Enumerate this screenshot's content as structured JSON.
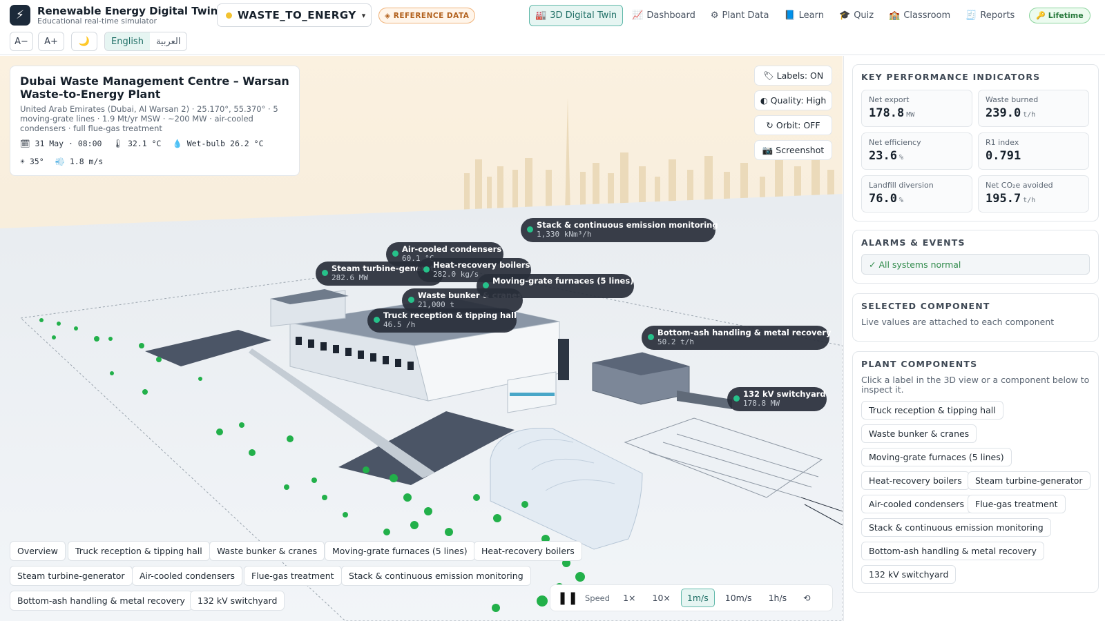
{
  "app": {
    "title": "Renewable Energy Digital Twin",
    "subtitle": "Educational real-time simulator",
    "logo": "⚡"
  },
  "plant_select": {
    "value": "WASTE_TO_ENERGY",
    "chevron": "▾"
  },
  "reference_badge": "◈ REFERENCE DATA",
  "nav": [
    {
      "icon": "🏭",
      "label": "3D Digital Twin",
      "active": true
    },
    {
      "icon": "📈",
      "label": "Dashboard"
    },
    {
      "icon": "⚙",
      "label": "Plant Data"
    },
    {
      "icon": "📘",
      "label": "Learn"
    },
    {
      "icon": "🎓",
      "label": "Quiz"
    },
    {
      "icon": "🏫",
      "label": "Classroom"
    },
    {
      "icon": "🧾",
      "label": "Reports"
    }
  ],
  "lifetime_badge": "🔑 Lifetime",
  "font_controls": {
    "decrease": "A−",
    "increase": "A+",
    "theme_icon": "🌙"
  },
  "language": {
    "english": "English",
    "arabic": "العربية"
  },
  "site": {
    "title": "Dubai Waste Management Centre – Warsan Waste-to-Energy Plant",
    "description": "United Arab Emirates (Dubai, Al Warsan 2) · 25.170°, 55.370° · 5 moving-grate lines · 1.9 Mt/yr MSW · ~200 MW · air-cooled condensers · full flue-gas treatment",
    "date": "🗓 31 May · 08:00",
    "temp": "🌡 32.1 °C",
    "wetbulb": "💧 Wet-bulb 26.2 °C",
    "sun": "☀ 35°",
    "wind": "💨 1.8 m/s"
  },
  "view_controls": {
    "labels": "🏷 Labels: ON",
    "quality": "◐ Quality: High",
    "orbit": "↻ Orbit: OFF",
    "screenshot": "📷 Screenshot"
  },
  "scene_labels": [
    {
      "name": "Stack & continuous emission monitoring",
      "value": "1,330 kNm³/h"
    },
    {
      "name": "Air-cooled condensers",
      "value": "60.1 °C"
    },
    {
      "name": "Steam turbine-generator",
      "value": "282.6 MW"
    },
    {
      "name": "Heat-recovery boilers",
      "value": "282.0 kg/s"
    },
    {
      "name": "Moving-grate furnaces (5 lines)",
      "value": ""
    },
    {
      "name": "Waste bunker & cranes",
      "value": "21,000 t"
    },
    {
      "name": "Truck reception & tipping hall",
      "value": "46.5 /h"
    },
    {
      "name": "Bottom-ash handling & metal recovery",
      "value": "50.2 t/h"
    },
    {
      "name": "132 kV switchyard",
      "value": "178.8 MW"
    }
  ],
  "component_chips": [
    "Overview",
    "Truck reception & tipping hall",
    "Waste bunker & cranes",
    "Moving-grate furnaces (5 lines)",
    "Heat-recovery boilers",
    "Steam turbine-generator",
    "Air-cooled condensers",
    "Flue-gas treatment",
    "Stack & continuous emission monitoring",
    "Bottom-ash handling & metal recovery",
    "132 kV switchyard"
  ],
  "speed": {
    "pause": "❚❚",
    "label": "Speed",
    "options": [
      "1×",
      "10×",
      "1m/s",
      "10m/s",
      "1h/s"
    ],
    "selected": "1m/s",
    "reset": "⟲"
  },
  "kpi": {
    "heading": "KEY PERFORMANCE INDICATORS",
    "items": [
      {
        "label": "Net export",
        "value": "178.8",
        "unit": "MW"
      },
      {
        "label": "Waste burned",
        "value": "239.0",
        "unit": "t/h"
      },
      {
        "label": "Net efficiency",
        "value": "23.6",
        "unit": "%"
      },
      {
        "label": "R1 index",
        "value": "0.791",
        "unit": ""
      },
      {
        "label": "Landfill diversion",
        "value": "76.0",
        "unit": "%"
      },
      {
        "label": "Net CO₂e avoided",
        "value": "195.7",
        "unit": "t/h"
      }
    ]
  },
  "alarms": {
    "heading": "ALARMS & EVENTS",
    "status": "✓ All systems normal"
  },
  "selected": {
    "heading": "SELECTED COMPONENT",
    "text": "Live values are attached to each component"
  },
  "components": {
    "heading": "PLANT COMPONENTS",
    "hint": "Click a label in the 3D view or a component below to inspect it.",
    "items": [
      "Truck reception & tipping hall",
      "Waste bunker & cranes",
      "Moving-grate furnaces (5 lines)",
      "Heat-recovery boilers",
      "Steam turbine-generator",
      "Air-cooled condensers",
      "Flue-gas treatment",
      "Stack & continuous emission monitoring",
      "Bottom-ash handling & metal recovery",
      "132 kV switchyard"
    ]
  }
}
